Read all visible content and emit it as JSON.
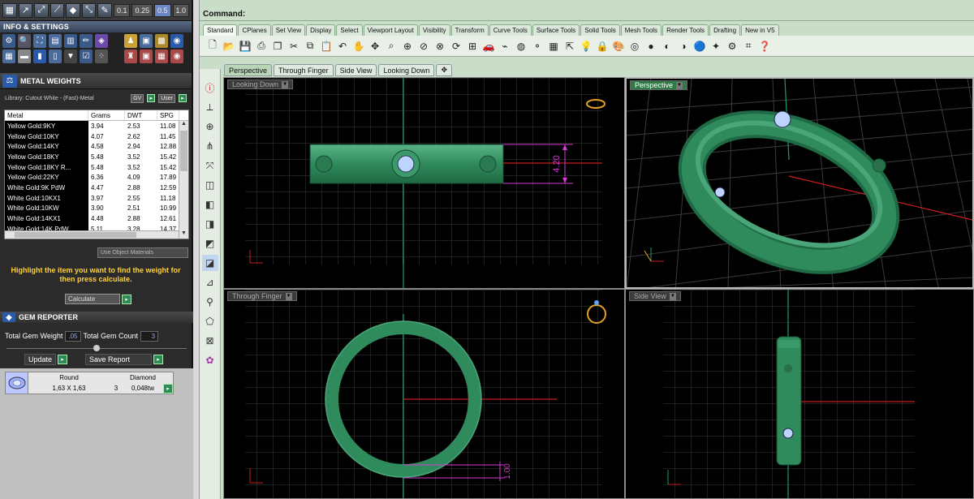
{
  "left_toolbar": {
    "zoom_values": [
      "0.1",
      "0.25",
      "0.5",
      "1.0"
    ],
    "zoom_selected": "0.5"
  },
  "info_settings": {
    "title": "INFO & SETTINGS"
  },
  "metal_weights": {
    "title": "METAL WEIGHTS",
    "library_label": "Library: Cutout White - (Fast)-Metal",
    "gv_label": "GV",
    "user_label": "User",
    "columns": [
      "Metal",
      "Grams",
      "DWT",
      "SPG"
    ],
    "rows": [
      [
        "Yellow Gold:9KY",
        "3.94",
        "2.53",
        "11.08"
      ],
      [
        "Yellow Gold:10KY",
        "4.07",
        "2.62",
        "11.45"
      ],
      [
        "Yellow Gold:14KY",
        "4.58",
        "2.94",
        "12.88"
      ],
      [
        "Yellow Gold:18KY",
        "5.48",
        "3.52",
        "15.42"
      ],
      [
        "Yellow Gold:18KY R...",
        "5.48",
        "3.52",
        "15.42"
      ],
      [
        "Yellow Gold:22KY",
        "6.36",
        "4.09",
        "17.89"
      ],
      [
        "White Gold:9K PdW",
        "4.47",
        "2.88",
        "12.59"
      ],
      [
        "White Gold:10KX1",
        "3.97",
        "2.55",
        "11.18"
      ],
      [
        "White Gold:10KW",
        "3.90",
        "2.51",
        "10.99"
      ],
      [
        "White Gold:14KX1",
        "4.48",
        "2.88",
        "12.61"
      ],
      [
        "White Gold:14K PdW",
        "5.11",
        "3.28",
        "14.37"
      ]
    ],
    "use_object_materials": "Use Object Materials",
    "hint": "Highlight the item you want to find the weight for then press calculate.",
    "calculate_label": "Calculate"
  },
  "gem_reporter": {
    "title": "GEM REPORTER",
    "total_weight_label": "Total Gem Weight",
    "total_weight_value": ".05",
    "total_count_label": "Total Gem Count",
    "total_count_value": "3",
    "update_label": "Update",
    "save_report_label": "Save Report",
    "gem": {
      "shape": "Round",
      "size": "1,63 X 1,63",
      "count": "3",
      "type": "Diamond",
      "weight": "0,048tw"
    }
  },
  "command": {
    "label": "Command:"
  },
  "toolbar_tabs": [
    "Standard",
    "CPlanes",
    "Set View",
    "Display",
    "Select",
    "Viewport Layout",
    "Visibility",
    "Transform",
    "Curve Tools",
    "Surface Tools",
    "Solid Tools",
    "Mesh Tools",
    "Render Tools",
    "Drafting",
    "New in V5"
  ],
  "toolbar_tabs_active": "Standard",
  "viewport_tabs": [
    "Perspective",
    "Through Finger",
    "Side View",
    "Looking Down"
  ],
  "viewport_tabs_active": "Perspective",
  "viewports": {
    "top_left": "Looking Down",
    "top_right": "Perspective",
    "bottom_left": "Through Finger",
    "bottom_right": "Side View"
  },
  "dimensions": {
    "top_view": "4.20",
    "finger_view": "1.00"
  },
  "colors": {
    "model_green": "#2f8a5c",
    "dimension_magenta": "#d43cd4",
    "axis_red": "#c81e1e",
    "axis_green": "#1e9a6e",
    "grid": "#3c3c3c",
    "gem_blue": "#bcd4ff"
  }
}
